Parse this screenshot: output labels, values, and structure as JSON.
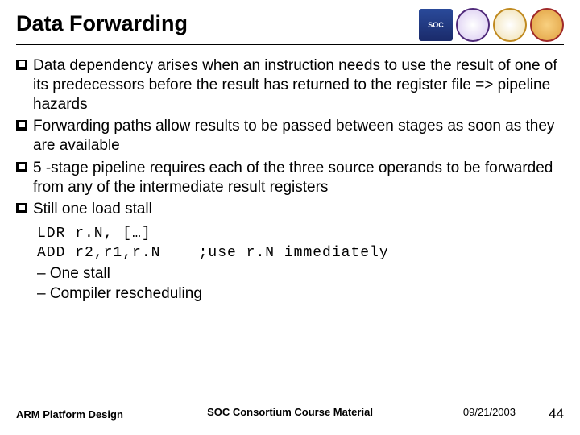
{
  "title": "Data Forwarding",
  "bullets": [
    "Data dependency arises when an instruction needs to use the result of one of its predecessors before the result has returned to the register file => pipeline hazards",
    "Forwarding paths allow results to be passed between stages as soon as they are available",
    "5 -stage pipeline requires each of the three source operands to be forwarded from any of the intermediate result registers",
    "Still one load stall"
  ],
  "code": {
    "line1": "LDR r.N, […]",
    "line2": "ADD r2,r1,r.N    ;use r.N immediately"
  },
  "dashes": [
    "One stall",
    "Compiler rescheduling"
  ],
  "footer": {
    "left": "ARM Platform Design",
    "center": "SOC Consortium Course Material",
    "date": "09/21/2003",
    "page": "44"
  },
  "logos": {
    "soc": "SOC"
  }
}
